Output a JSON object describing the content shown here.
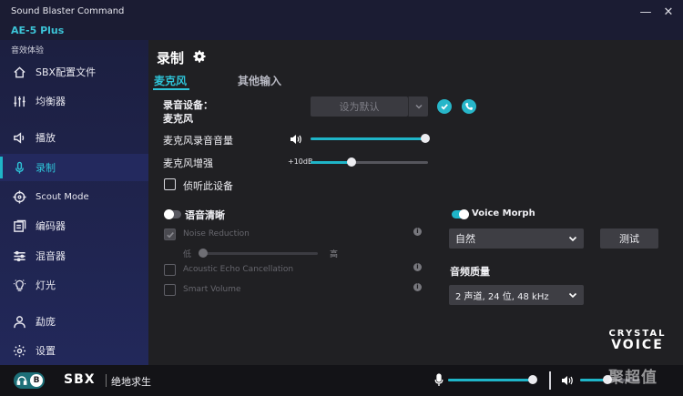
{
  "window": {
    "app_title": "Sound Blaster Command",
    "device_name": "AE-5 Plus",
    "minimize": "—",
    "close": "✕"
  },
  "sidebar": {
    "section_label": "音效体验",
    "items": [
      {
        "label": "SBX配置文件",
        "icon": "home-icon"
      },
      {
        "label": "均衡器",
        "icon": "equalizer-icon"
      },
      {
        "label": "播放",
        "icon": "speaker-icon"
      },
      {
        "label": "录制",
        "icon": "microphone-icon",
        "active": true
      },
      {
        "label": "Scout Mode",
        "icon": "crosshair-icon"
      },
      {
        "label": "编码器",
        "icon": "encoder-icon"
      },
      {
        "label": "混音器",
        "icon": "mixer-icon"
      },
      {
        "label": "灯光",
        "icon": "bulb-icon"
      },
      {
        "label": "勐庞",
        "icon": "user-icon"
      },
      {
        "label": "设置",
        "icon": "gear-icon"
      }
    ]
  },
  "main": {
    "title": "录制",
    "tabs": [
      {
        "label": "麦克风",
        "active": true
      },
      {
        "label": "其他输入",
        "active": false
      }
    ],
    "recording_device": {
      "label_line1": "录音设备：",
      "label_line2": "麦克风",
      "set_default_button": "设为默认"
    },
    "mic_volume": {
      "label": "麦克风录音音量",
      "value": 100
    },
    "mic_boost": {
      "label": "麦克风增强",
      "boost_text": "+10dB",
      "value": 35
    },
    "monitor_device": {
      "label": "侦听此设备",
      "checked": false
    },
    "voice_clarity": {
      "label": "语音清晰",
      "enabled": false,
      "noise_reduction": {
        "label": "Noise Reduction",
        "checked": true,
        "low": "低",
        "high": "高",
        "value": 0
      },
      "echo_cancellation": {
        "label": "Acoustic Echo Cancellation",
        "checked": false
      },
      "smart_volume": {
        "label": "Smart Volume",
        "checked": false
      }
    },
    "voice_morph": {
      "label": "Voice Morph",
      "enabled": true,
      "selected": "自然",
      "test_button": "测试"
    },
    "audio_quality": {
      "label": "音频质量",
      "selected": "2 声道, 24 位, 48 kHz"
    },
    "logo_line1": "CRYSTAL",
    "logo_line2": "VOICE"
  },
  "bottombar": {
    "badge": "B",
    "brand": "SBX",
    "profile": "绝地求生",
    "mic_level": 100,
    "speaker_level": 45
  },
  "watermark": "聚超值",
  "colors": {
    "accent": "#1fb5c8",
    "sidebar_bg": "#1f234a",
    "panel_bg": "#202023"
  }
}
